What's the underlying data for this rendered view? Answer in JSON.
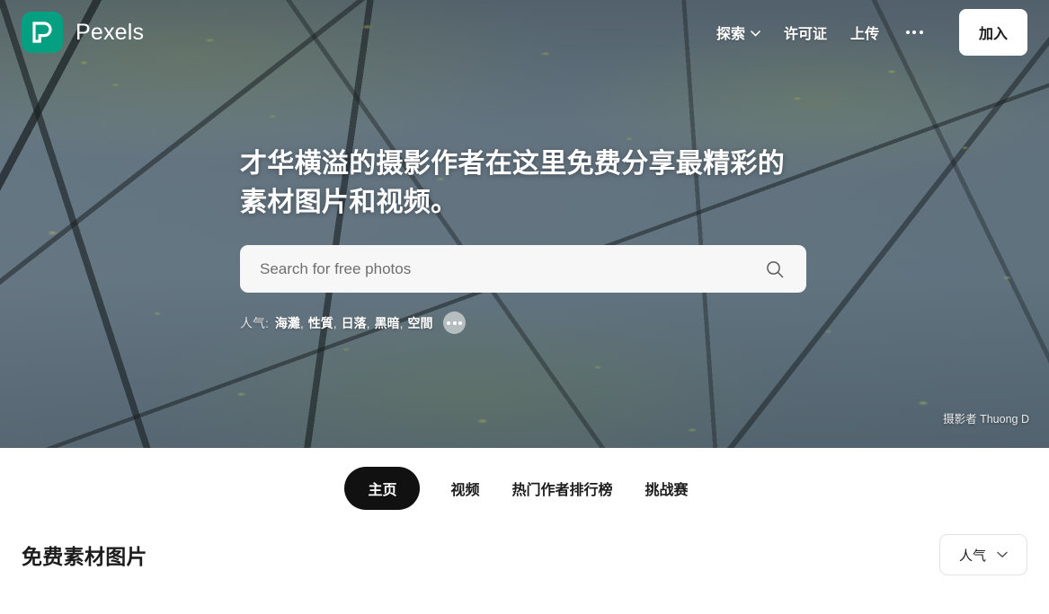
{
  "brand": {
    "name": "Pexels",
    "logo_icon": "pexels-p-logo-icon",
    "logo_color": "#05A081"
  },
  "header": {
    "nav": [
      {
        "label": "探索",
        "icon": "chevron-down-icon",
        "has_chevron": true
      },
      {
        "label": "许可证",
        "has_chevron": false
      },
      {
        "label": "上传",
        "has_chevron": false
      }
    ],
    "more_icon": "ellipsis-horizontal-icon",
    "join_label": "加入"
  },
  "hero": {
    "headline": "才华横溢的摄影作者在这里免费分享最精彩的素材图片和视频。",
    "search": {
      "placeholder": "Search for free photos",
      "value": "",
      "icon": "search-icon"
    },
    "tags": {
      "label": "人气:",
      "items": [
        "海灘",
        "性質",
        "日落",
        "黑暗",
        "空間"
      ],
      "separator": ",",
      "more_icon": "ellipsis-circle-icon"
    },
    "credit": "摄影者 Thuong D"
  },
  "tabs": [
    {
      "label": "主页",
      "active": true
    },
    {
      "label": "视频",
      "active": false
    },
    {
      "label": "热门作者排行榜",
      "active": false
    },
    {
      "label": "挑战赛",
      "active": false
    }
  ],
  "section": {
    "title": "免费素材图片",
    "sort": {
      "value": "人气",
      "icon": "chevron-down-icon"
    }
  }
}
